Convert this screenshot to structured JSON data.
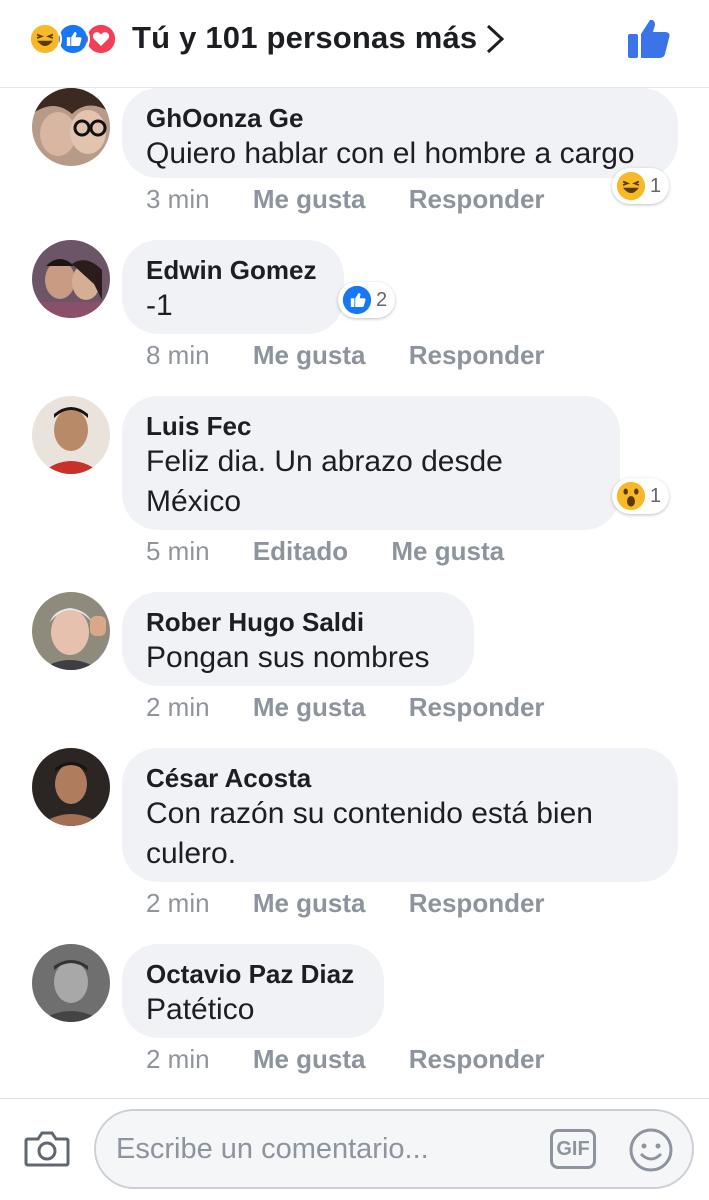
{
  "header": {
    "title": "Tú y 101 personas más",
    "reactions": [
      "laugh",
      "like",
      "love"
    ]
  },
  "colors": {
    "accent": "#3b5998",
    "like_blue": "#1877f2",
    "love_red": "#f33e58",
    "haha_yellow": "#f7b928",
    "bubble": "#f0f2f5",
    "meta_gray": "#90949c"
  },
  "comments": [
    {
      "author": "GhOonza Ge",
      "lines": [
        "Quiero hablar con el hombre a cargo"
      ],
      "time": "3 min",
      "actions": [
        "Me gusta",
        "Responder"
      ],
      "reaction": {
        "icon": "haha-icon",
        "count": "1"
      }
    },
    {
      "author": "Edwin Gomez",
      "lines": [
        "-1"
      ],
      "time": "8 min",
      "actions": [
        "Me gusta",
        "Responder"
      ],
      "reaction": {
        "icon": "like-icon",
        "count": "2"
      }
    },
    {
      "author": "Luis Fec",
      "lines": [
        "Feliz dia. Un abrazo desde",
        "México"
      ],
      "time": "5 min",
      "actions": [
        "Editado",
        "Me gusta"
      ],
      "reaction": {
        "icon": "wow-icon",
        "count": "1"
      }
    },
    {
      "author": "Rober Hugo Saldi",
      "lines": [
        "Pongan sus nombres"
      ],
      "time": "2 min",
      "actions": [
        "Me gusta",
        "Responder"
      ]
    },
    {
      "author": "César Acosta",
      "lines": [
        "Con razón su contenido está bien",
        "culero."
      ],
      "time": "2 min",
      "actions": [
        "Me gusta",
        "Responder"
      ]
    },
    {
      "author": "Octavio Paz Diaz",
      "lines": [
        "Patético"
      ],
      "time": "2 min",
      "actions": [
        "Me gusta",
        "Responder"
      ]
    }
  ],
  "composer": {
    "placeholder": "Escribe un comentario...",
    "gif_label": "GIF"
  }
}
